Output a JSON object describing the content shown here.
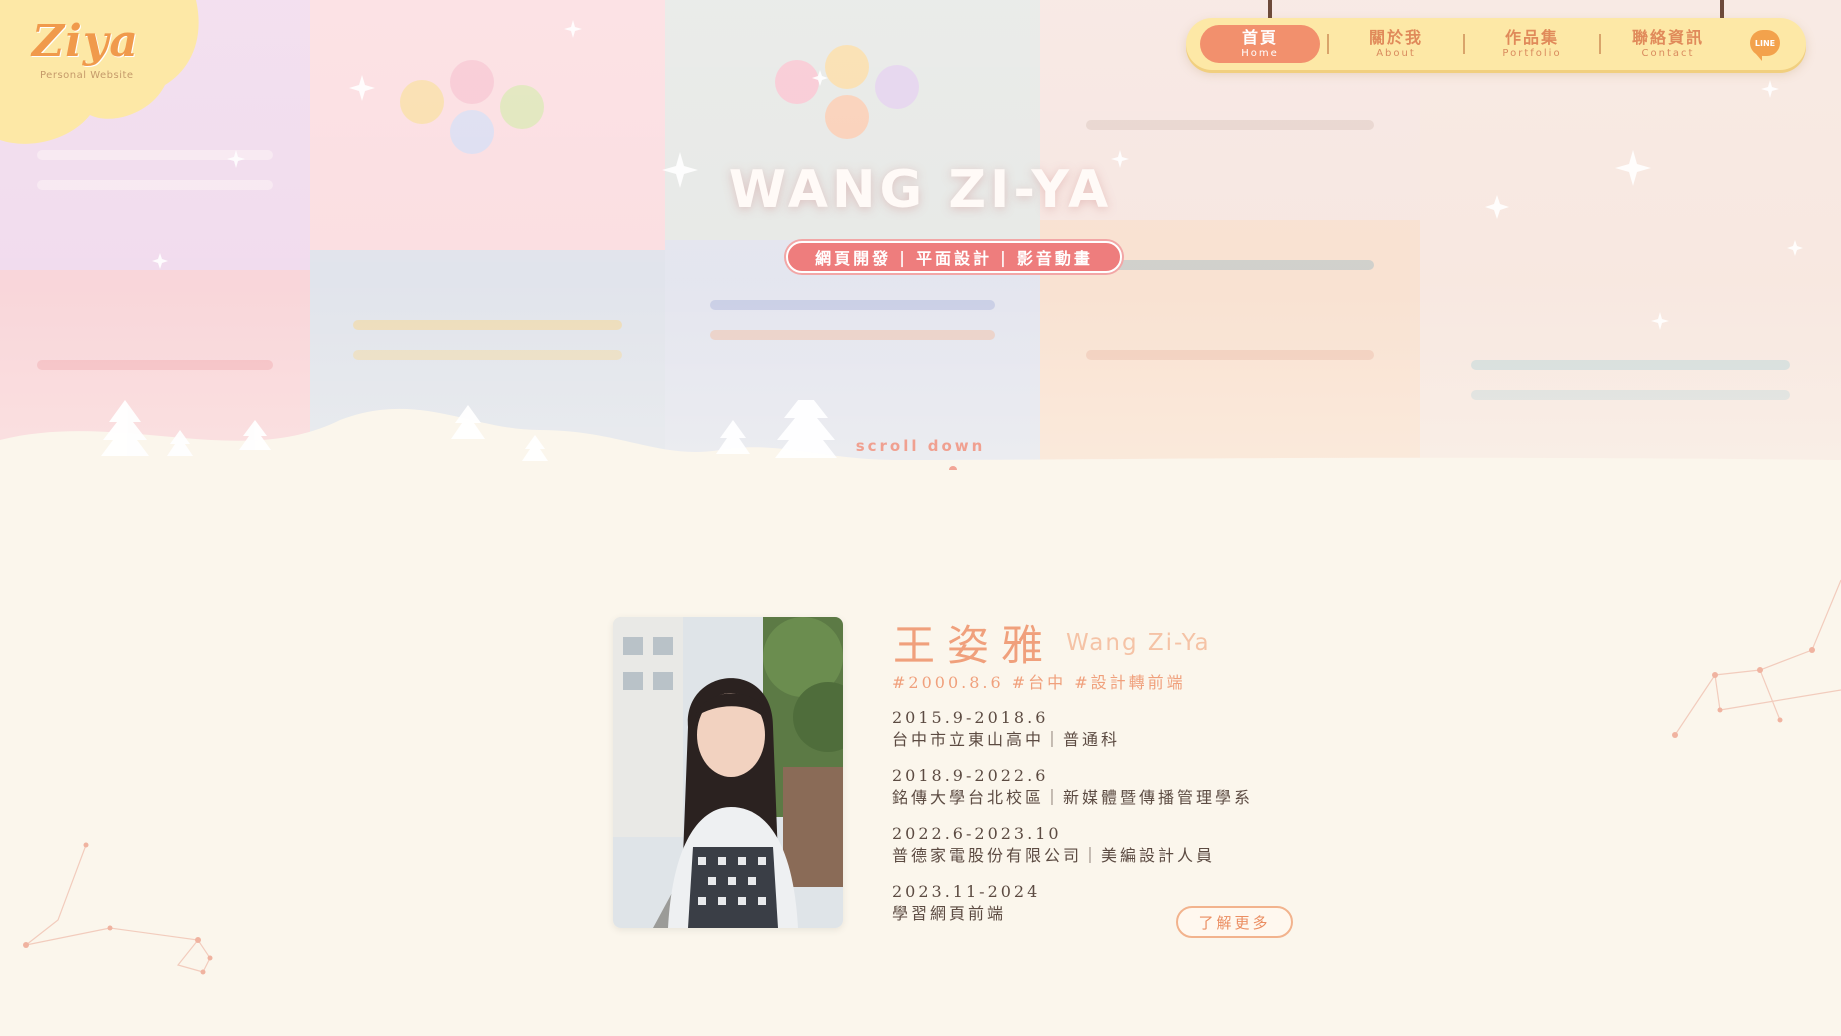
{
  "logo": {
    "text": "Ziya",
    "subtitle": "Personal Website"
  },
  "nav": {
    "items": [
      {
        "zh": "首頁",
        "en": "Home",
        "active": true
      },
      {
        "zh": "關於我",
        "en": "About",
        "active": false
      },
      {
        "zh": "作品集",
        "en": "Portfolio",
        "active": false
      },
      {
        "zh": "聯絡資訊",
        "en": "Contact",
        "active": false
      }
    ],
    "line_label": "LINE"
  },
  "hero": {
    "title": "WANG ZI-YA",
    "tags": [
      "網頁開發",
      "平面設計",
      "影音動畫"
    ],
    "tag_separator": "|",
    "scroll_label": "scroll down"
  },
  "about": {
    "name_zh": "王姿雅",
    "name_en": "Wang Zi-Ya",
    "hashtags": "#2000.8.6 #台中 #設計轉前端",
    "timeline": [
      {
        "date": "2015.9-2018.6",
        "desc": "台中市立東山高中｜普通科"
      },
      {
        "date": "2018.9-2022.6",
        "desc": "銘傳大學台北校區｜新媒體暨傳播管理學系"
      },
      {
        "date": "2022.6-2023.10",
        "desc": "普德家電股份有限公司｜美編設計人員"
      },
      {
        "date": "2023.11-2024",
        "desc": "學習網頁前端"
      }
    ],
    "more_button": "了解更多"
  },
  "colors": {
    "accent": "#f2906d",
    "nav_bg": "#fde8a6",
    "page_bg": "#fbf6ec",
    "tag_bg": "#ee7d7d"
  }
}
